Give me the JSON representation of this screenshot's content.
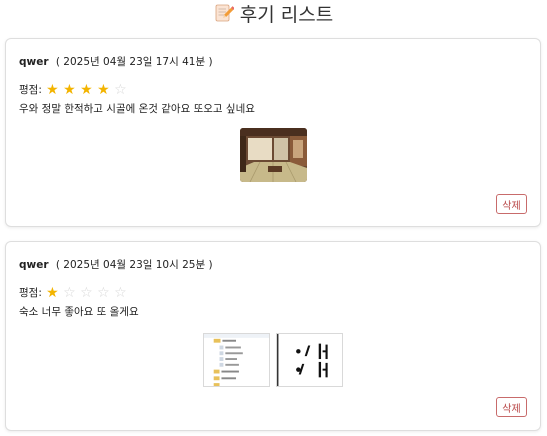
{
  "page": {
    "title": "후기 리스트",
    "title_icon": "memo-icon"
  },
  "colors": {
    "star_on": "#f3b400",
    "star_off": "#d7d7d7",
    "delete_border": "#c86b6b",
    "delete_text": "#b84545"
  },
  "reviews": [
    {
      "author": "qwer",
      "date": "( 2025년 04월 23일 17시 41분 )",
      "rating_label": "평점:",
      "rating": 4,
      "rating_max": 5,
      "comment": "우와 정말 한적하고 시골에 온것 같아요 또오고 싶네요",
      "images": [
        "room-photo"
      ],
      "delete_label": "삭제"
    },
    {
      "author": "qwer",
      "date": "( 2025년 04월 23일 10시 25분 )",
      "rating_label": "평점:",
      "rating": 1,
      "rating_max": 5,
      "comment": "숙소 너무 좋아요 또 올게요",
      "images": [
        "file-tree-screenshot",
        "bullet-list-screenshot"
      ],
      "delete_label": "삭제"
    }
  ]
}
